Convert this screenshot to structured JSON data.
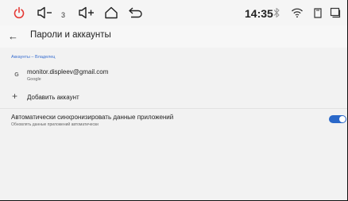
{
  "statusbar": {
    "volume_level": "3",
    "time": "14:35",
    "colors": {
      "power": "#e53935"
    }
  },
  "appbar": {
    "back_icon": "←",
    "title": "Пароли и аккаунты"
  },
  "accounts": {
    "section_label": "Аккаунты – Владелец",
    "items": [
      {
        "email": "monitor.displeev@gmail.com",
        "provider": "Google",
        "icon": "google-icon"
      }
    ],
    "add_label": "Добавить аккаунт"
  },
  "sync": {
    "title": "Автоматически синхронизировать данные приложений",
    "subtitle": "Обновлять данные приложений автоматически",
    "enabled": true,
    "toggle_color": "#2a68c9"
  }
}
